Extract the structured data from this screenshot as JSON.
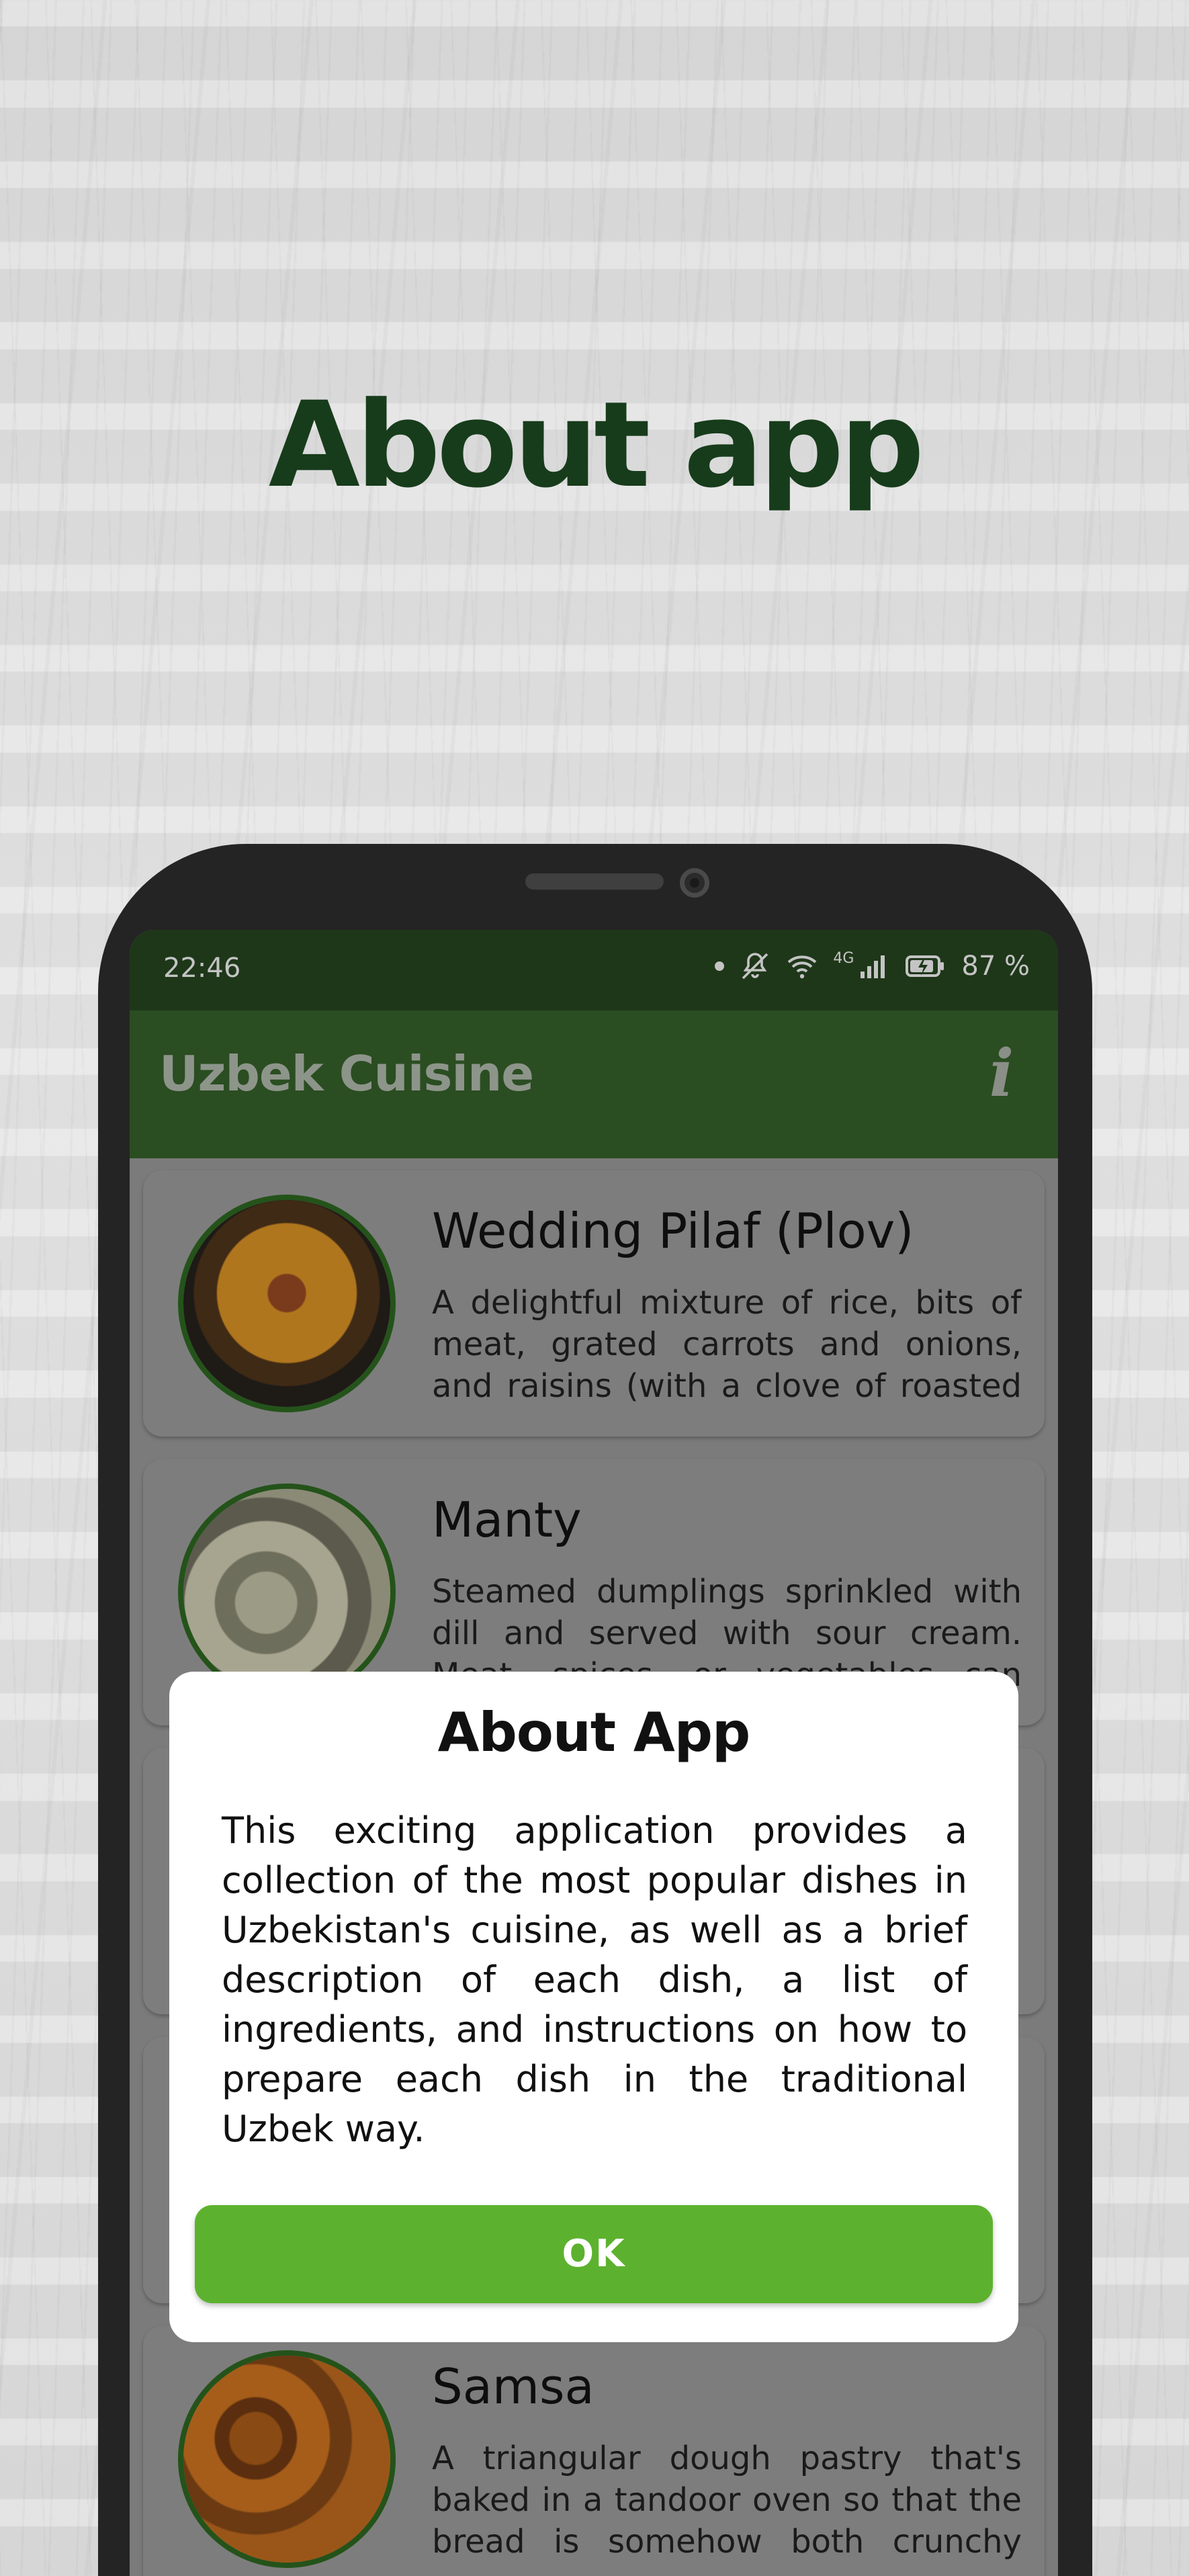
{
  "headline": "About app",
  "status_bar": {
    "time": "22:46",
    "network_label": "4G",
    "battery": "87 %"
  },
  "app_bar": {
    "title": "Uzbek Cuisine",
    "info_icon": "info-icon"
  },
  "dishes": [
    {
      "name": "Wedding Pilaf (Plov)",
      "description": "A delightful mixture of rice, bits of meat, grated carrots and onions, and raisins (with a clove of roasted garli..."
    },
    {
      "name": "Manty",
      "description": "Steamed dumplings sprinkled with dill and served with sour cream. Meat, spices, or vegetables can make up t..."
    },
    {
      "name": "Samsa",
      "description": "A triangular dough pastry that's baked in a tandoor oven so that the bread is somehow both crunchy an..."
    }
  ],
  "dialog": {
    "title": "About App",
    "body": "This exciting application provides a collection of the most popular dishes in Uzbekistan's cuisine, as well as a brief description of each dish, a list of ingredients, and instructions on how to prepare each dish in the traditional Uzbek way.",
    "ok_label": "OK"
  },
  "colors": {
    "headline": "#173c1b",
    "status_bar": "#1e3719",
    "app_bar": "#2b4d22",
    "ok_button": "#5cb22e",
    "thumb_border": "#24531a"
  }
}
